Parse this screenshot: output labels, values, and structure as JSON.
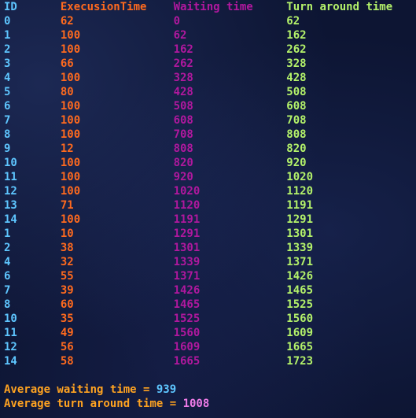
{
  "headers": {
    "id": "ID",
    "exec": "ExecusionTime",
    "wait": "Waiting time",
    "turn": "Turn around time"
  },
  "rows": [
    {
      "id": "0",
      "exec": "62",
      "wait": "0",
      "turn": "62"
    },
    {
      "id": "1",
      "exec": "100",
      "wait": "62",
      "turn": "162"
    },
    {
      "id": "2",
      "exec": "100",
      "wait": "162",
      "turn": "262"
    },
    {
      "id": "3",
      "exec": "66",
      "wait": "262",
      "turn": "328"
    },
    {
      "id": "4",
      "exec": "100",
      "wait": "328",
      "turn": "428"
    },
    {
      "id": "5",
      "exec": "80",
      "wait": "428",
      "turn": "508"
    },
    {
      "id": "6",
      "exec": "100",
      "wait": "508",
      "turn": "608"
    },
    {
      "id": "7",
      "exec": "100",
      "wait": "608",
      "turn": "708"
    },
    {
      "id": "8",
      "exec": "100",
      "wait": "708",
      "turn": "808"
    },
    {
      "id": "9",
      "exec": "12",
      "wait": "808",
      "turn": "820"
    },
    {
      "id": "10",
      "exec": "100",
      "wait": "820",
      "turn": "920"
    },
    {
      "id": "11",
      "exec": "100",
      "wait": "920",
      "turn": "1020"
    },
    {
      "id": "12",
      "exec": "100",
      "wait": "1020",
      "turn": "1120"
    },
    {
      "id": "13",
      "exec": "71",
      "wait": "1120",
      "turn": "1191"
    },
    {
      "id": "14",
      "exec": "100",
      "wait": "1191",
      "turn": "1291"
    },
    {
      "id": "1",
      "exec": "10",
      "wait": "1291",
      "turn": "1301"
    },
    {
      "id": "2",
      "exec": "38",
      "wait": "1301",
      "turn": "1339"
    },
    {
      "id": "4",
      "exec": "32",
      "wait": "1339",
      "turn": "1371"
    },
    {
      "id": "6",
      "exec": "55",
      "wait": "1371",
      "turn": "1426"
    },
    {
      "id": "7",
      "exec": "39",
      "wait": "1426",
      "turn": "1465"
    },
    {
      "id": "8",
      "exec": "60",
      "wait": "1465",
      "turn": "1525"
    },
    {
      "id": "10",
      "exec": "35",
      "wait": "1525",
      "turn": "1560"
    },
    {
      "id": "11",
      "exec": "49",
      "wait": "1560",
      "turn": "1609"
    },
    {
      "id": "12",
      "exec": "56",
      "wait": "1609",
      "turn": "1665"
    },
    {
      "id": "14",
      "exec": "58",
      "wait": "1665",
      "turn": "1723"
    }
  ],
  "summary": {
    "avg_wait_label": "Average waiting time = ",
    "avg_wait_value": "939",
    "avg_turn_label": "Average turn around time = ",
    "avg_turn_value": "1008"
  },
  "colors": {
    "background": "#0d1533",
    "id": "#5ec6ff",
    "exec": "#ff6a1e",
    "wait": "#b0189e",
    "turn": "#b4f26a",
    "summary_label": "#ffa321",
    "summary_turn_value": "#f07ce8"
  }
}
